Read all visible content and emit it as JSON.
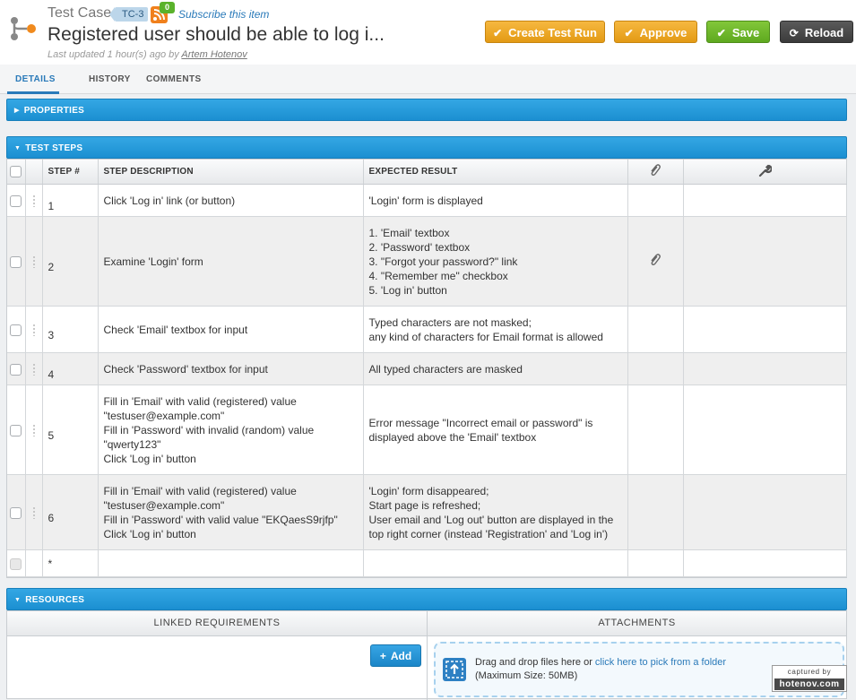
{
  "header": {
    "type_label": "Test Case",
    "id": "TC-3",
    "rss_count": "0",
    "subscribe": "Subscribe this item",
    "title": "Registered user should be able to log i...",
    "meta_prefix": "Last updated 1 hour(s) ago by",
    "meta_user": "Artem Hotenov"
  },
  "toolbar": {
    "create_run": "Create Test Run",
    "approve": "Approve",
    "save": "Save",
    "reload": "Reload"
  },
  "tabs": [
    "DETAILS",
    "HISTORY",
    "COMMENTS"
  ],
  "sections": {
    "properties": "PROPERTIES",
    "test_steps": "TEST STEPS",
    "resources": "RESOURCES"
  },
  "steps_table": {
    "columns": [
      "STEP #",
      "STEP DESCRIPTION",
      "EXPECTED RESULT"
    ],
    "attach_icon": "paperclip-icon",
    "tools_icon": "wrench-icon",
    "rows": [
      {
        "num": "1",
        "desc": [
          "Click 'Log in' link (or button)"
        ],
        "result": [
          "'Login' form is displayed"
        ],
        "attach": false
      },
      {
        "num": "2",
        "desc": [
          "Examine 'Login' form"
        ],
        "result": [
          "1. 'Email' textbox",
          "2. 'Password' textbox",
          "3. \"Forgot your password?\" link",
          "4. \"Remember me\" checkbox",
          "5. 'Log in' button"
        ],
        "attach": true
      },
      {
        "num": "3",
        "desc": [
          "Check 'Email' textbox for input"
        ],
        "result": [
          "Typed characters are not masked;",
          "any kind of characters for Email format is allowed"
        ],
        "attach": false
      },
      {
        "num": "4",
        "desc": [
          "Check 'Password' textbox for input"
        ],
        "result": [
          "All typed characters are masked"
        ],
        "attach": false
      },
      {
        "num": "5",
        "desc": [
          "Fill in 'Email' with valid (registered) value",
          "\"testuser@example.com\"",
          "Fill in 'Password' with invalid (random) value",
          "\"qwerty123\"",
          "Click 'Log in' button"
        ],
        "result": [
          "Error message \"Incorrect email or password\" is",
          "displayed above the 'Email' textbox"
        ],
        "attach": false
      },
      {
        "num": "6",
        "desc": [
          "Fill in 'Email' with valid (registered) value",
          "\"testuser@example.com\"",
          "Fill in 'Password' with valid value \"EKQaesS9rjfp\"",
          "Click 'Log in' button"
        ],
        "result": [
          "'Login' form disappeared;",
          "Start page is refreshed;",
          "User email and 'Log out' button are displayed in the",
          "top right corner (instead 'Registration' and 'Log in')"
        ],
        "attach": false
      }
    ],
    "new_row_marker": "*"
  },
  "resources": {
    "linked_header": "LINKED REQUIREMENTS",
    "attachments_header": "ATTACHMENTS",
    "add_label": "Add",
    "drop_text": "Drag and drop files here or",
    "drop_link": "click here to pick from a folder",
    "drop_limit": "(Maximum Size: 50MB)"
  },
  "watermark": {
    "top": "captured by",
    "bottom": "hotenov.com"
  },
  "colors": {
    "accent_blue": "#1b8fd1",
    "orange_button": "#e39a14",
    "green_button": "#5ea91f",
    "dark_button": "#3b3b3b"
  }
}
